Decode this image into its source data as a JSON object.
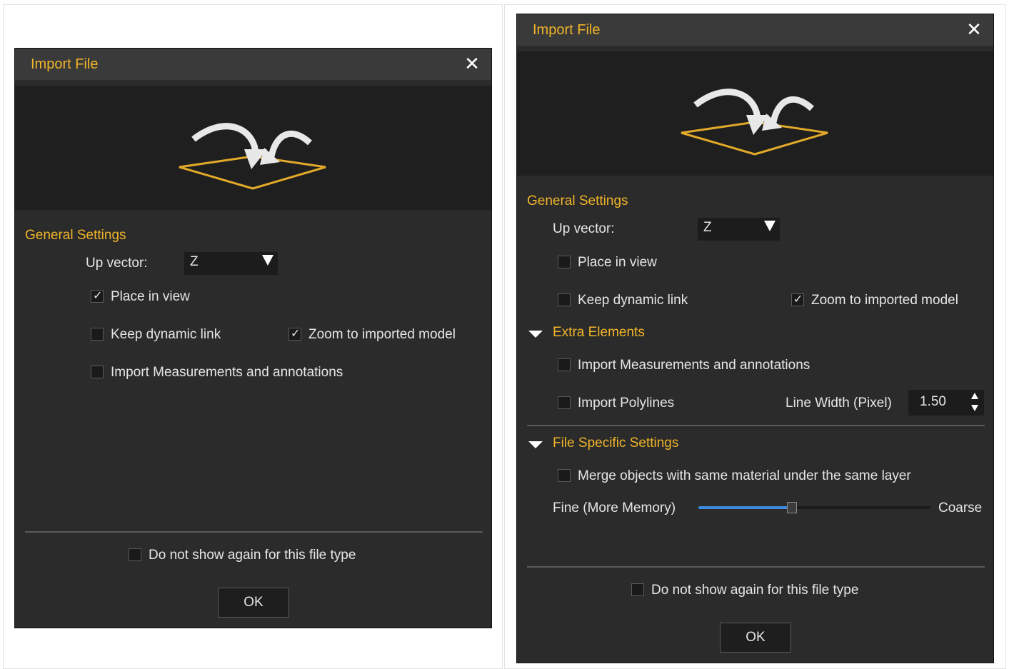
{
  "dialog_a": {
    "title": "Import File",
    "close_glyph": "✕",
    "general_settings": "General Settings",
    "up_vector_label": "Up vector:",
    "up_vector_value": "Z",
    "place_in_view": {
      "label": "Place in view",
      "checked": true
    },
    "keep_dynamic_link": {
      "label": "Keep dynamic link",
      "checked": false
    },
    "zoom_to_model": {
      "label": "Zoom to imported model",
      "checked": true
    },
    "import_measurements": {
      "label": "Import Measurements and annotations",
      "checked": false
    },
    "do_not_show": {
      "label": "Do not show again for this file type",
      "checked": false
    },
    "ok_label": "OK"
  },
  "dialog_b": {
    "title": "Import File",
    "close_glyph": "✕",
    "general_settings": "General Settings",
    "up_vector_label": "Up vector:",
    "up_vector_value": "Z",
    "place_in_view": {
      "label": "Place in view",
      "checked": false
    },
    "keep_dynamic_link": {
      "label": "Keep dynamic link",
      "checked": false
    },
    "zoom_to_model": {
      "label": "Zoom to imported model",
      "checked": true
    },
    "extra_elements": "Extra Elements",
    "import_measurements": {
      "label": "Import Measurements and annotations",
      "checked": false
    },
    "import_polylines": {
      "label": "Import Polylines",
      "checked": false
    },
    "line_width_label": "Line Width (Pixel)",
    "line_width_value": "1.50",
    "file_specific": "File Specific Settings",
    "merge_objects": {
      "label": "Merge objects with same material under the same layer",
      "checked": false
    },
    "slider_left_label": "Fine (More Memory)",
    "slider_right_label": "Coarse",
    "slider_value_fraction": 0.4,
    "do_not_show": {
      "label": "Do not show again for this file type",
      "checked": false
    },
    "ok_label": "OK"
  },
  "colors": {
    "accent": "#f0b429",
    "dialog_bg": "#2b2b2b",
    "titlebar_bg": "#3a3a3a",
    "slider_fill": "#3d8be0"
  },
  "icons": {
    "hero": "import-arrows-plane-icon",
    "checkmark": "✓"
  }
}
